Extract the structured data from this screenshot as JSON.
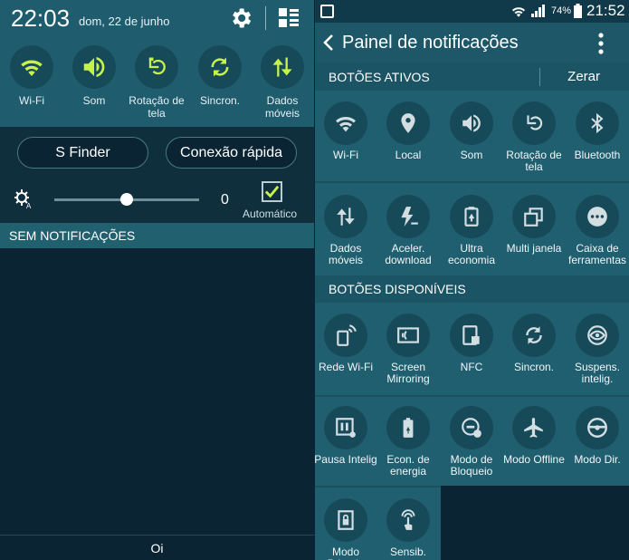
{
  "left": {
    "time": "22:03",
    "date": "dom, 22 de junho",
    "quick_toggles": [
      {
        "label": "Wi-Fi",
        "icon": "wifi-icon",
        "active": true
      },
      {
        "label": "Som",
        "icon": "volume-icon",
        "active": true
      },
      {
        "label": "Rotação de tela",
        "icon": "rotation-icon",
        "active": true
      },
      {
        "label": "Sincron.",
        "icon": "sync-icon",
        "active": true
      },
      {
        "label": "Dados móveis",
        "icon": "mobile-data-icon",
        "active": true
      }
    ],
    "s_finder_label": "S Finder",
    "quick_connect_label": "Conexão rápida",
    "brightness_value": "0",
    "brightness_level": 0.5,
    "auto_label": "Automático",
    "auto_checked": true,
    "no_notifications": "SEM NOTIFICAÇÕES",
    "carrier": "Oi"
  },
  "right": {
    "battery": "74%",
    "clock": "21:52",
    "title": "Painel de notificações",
    "active_section": "BOTÕES ATIVOS",
    "reset_label": "Zerar",
    "active_buttons": [
      {
        "label": "Wi-Fi",
        "icon": "wifi-icon"
      },
      {
        "label": "Local",
        "icon": "location-icon"
      },
      {
        "label": "Som",
        "icon": "volume-icon"
      },
      {
        "label": "Rotação de tela",
        "icon": "rotation-icon"
      },
      {
        "label": "Bluetooth",
        "icon": "bluetooth-icon"
      },
      {
        "label": "Dados móveis",
        "icon": "mobile-data-icon"
      },
      {
        "label": "Aceler. download",
        "icon": "download-booster-icon"
      },
      {
        "label": "Ultra economia",
        "icon": "ultra-saving-icon"
      },
      {
        "label": "Multi janela",
        "icon": "multi-window-icon"
      },
      {
        "label": "Caixa de ferramentas",
        "icon": "toolbox-icon"
      }
    ],
    "available_section": "BOTÕES DISPONÍVEIS",
    "available_buttons": [
      {
        "label": "Rede Wi-Fi",
        "icon": "wifi-hotspot-icon"
      },
      {
        "label": "Screen Mirroring",
        "icon": "screen-mirroring-icon"
      },
      {
        "label": "NFC",
        "icon": "nfc-icon"
      },
      {
        "label": "Sincron.",
        "icon": "sync-icon"
      },
      {
        "label": "Suspens. intelig.",
        "icon": "smart-stay-icon"
      },
      {
        "label": "Pausa Intelig",
        "icon": "smart-pause-icon"
      },
      {
        "label": "Econ. de energia",
        "icon": "power-saving-icon"
      },
      {
        "label": "Modo de Bloqueio",
        "icon": "blocking-mode-icon"
      },
      {
        "label": "Modo Offline",
        "icon": "airplane-icon"
      },
      {
        "label": "Modo Dir.",
        "icon": "driving-mode-icon"
      },
      {
        "label": "Modo Privado",
        "icon": "private-mode-icon"
      },
      {
        "label": "Sensib. toque",
        "icon": "touch-sensitivity-icon"
      }
    ]
  },
  "colors": {
    "accent": "#c6f24a",
    "icon": "#d3dee2",
    "header": "#1f5d6e",
    "background": "#0b2433"
  }
}
